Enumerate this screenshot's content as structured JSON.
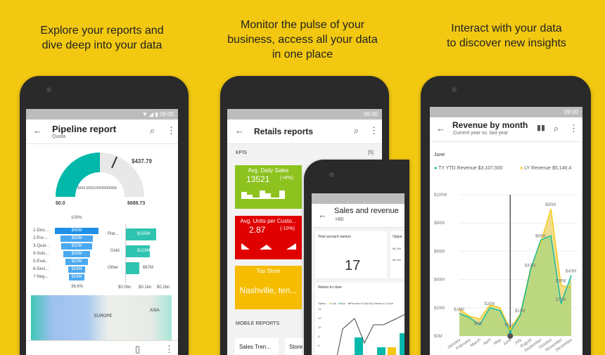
{
  "captions": [
    "Explore your reports and\ndive deep into your data",
    "Monitor the pulse of your\nbusiness, access all your data\nin one place",
    "Interact with your data\nto discover new insights"
  ],
  "status_time": "09:00",
  "pipeline": {
    "title": "Pipeline report",
    "subtitle": "Quota",
    "gauge": {
      "value_label": "$344.36921400000000M",
      "target": "$437.79",
      "min": "$0.0",
      "max": "$688.73",
      "fraction": 0.5,
      "target_fraction": 0.636
    },
    "funnel": {
      "top": "100%",
      "bottom": "36.6%",
      "rows": [
        {
          "label": "1-Disc...",
          "value": "$45M",
          "v": 45
        },
        {
          "label": "2-Pre-...",
          "value": "$33M",
          "v": 33
        },
        {
          "label": "3-Qual...",
          "value": "$32M",
          "v": 32
        },
        {
          "label": "4-Solu...",
          "value": "$28M",
          "v": 28
        },
        {
          "label": "5-Eval...",
          "value": "$23M",
          "v": 23
        },
        {
          "label": "6-Deci...",
          "value": "$18M",
          "v": 18
        },
        {
          "label": "7-Neg...",
          "value": "$16M",
          "v": 16
        }
      ]
    },
    "bars": {
      "rows": [
        {
          "label": "Plat...",
          "value": "$155M",
          "v": 155
        },
        {
          "label": "Gold",
          "value": "$123M",
          "v": 123
        },
        {
          "label": "Other",
          "value": "$67M",
          "v": 67
        }
      ],
      "ticks": [
        "$0.0bn",
        "$0.1bn",
        "$0.2bn"
      ]
    },
    "map": {
      "labels": [
        "EUROPE",
        "ASIA"
      ]
    }
  },
  "retail": {
    "title": "Retails reports",
    "kpis_label": "KPIS",
    "kpis_count": "[5]",
    "tiles": [
      {
        "title": "Avg. Daily Sales",
        "value": "13521",
        "change": "(+8%)",
        "color": "#8DC21F"
      },
      {
        "title": "Avg. Units per Custo...",
        "value": "2.87",
        "change": "(-10%)",
        "color": "#E00000"
      },
      {
        "title": "Top Store",
        "value": "Nashville, ten...",
        "color": "#F5BC00"
      }
    ],
    "mobile_label": "MOBILE REPORTS",
    "mobile_items": [
      "Sales Tren...",
      "Store"
    ]
  },
  "sales": {
    "title": "Sales and revenue",
    "subtitle": "HBI",
    "card1_title": "Total account owners",
    "card1_value": "17",
    "card2_title": "Oppor",
    "card2_ticks": [
      "$0.2bn",
      "$0.1bn"
    ],
    "weeks_title": "Weeks to close",
    "legend": [
      "Status",
      "Lost",
      "Won",
      "Percent of Ops By Weeks to Close"
    ],
    "yticks": [
      "14",
      "12",
      "10",
      "8",
      "6"
    ]
  },
  "revenue": {
    "title": "Revenue by month",
    "subtitle": "Current year vs. last year",
    "selected": "June",
    "legend_ty": "TY YTD Revenue $3,107,500",
    "legend_ly": "LY Revenue $5,140,4"
  },
  "chart_data": {
    "type": "area",
    "categories": [
      "January",
      "February",
      "March",
      "April",
      "May",
      "June",
      "July",
      "August",
      "September",
      "October",
      "November",
      "December"
    ],
    "series": [
      {
        "name": "TY YTD Revenue",
        "color": "#01B8AA",
        "values": [
          16,
          13,
          8,
          20,
          18,
          3,
          15,
          47,
          68,
          71,
          23,
          43
        ]
      },
      {
        "name": "LY Revenue",
        "color": "#F2C811",
        "values": [
          19,
          14,
          12,
          22,
          20,
          5,
          16,
          48,
          66,
          90,
          36,
          34
        ]
      }
    ],
    "yticks": [
      "$0M",
      "$20M",
      "$40M",
      "$60M",
      "$80M",
      "$100M"
    ],
    "ylim": [
      0,
      100
    ],
    "data_labels": [
      {
        "i": 0,
        "t": "$16M",
        "v": 16
      },
      {
        "i": 2,
        "t": "$6M",
        "v": 6
      },
      {
        "i": 3,
        "t": "$20M",
        "v": 20
      },
      {
        "i": 5,
        "t": "$5M",
        "v": 5
      },
      {
        "i": 6,
        "t": "$15M",
        "v": 15
      },
      {
        "i": 7,
        "t": "$47M",
        "v": 47
      },
      {
        "i": 8,
        "t": "$68M",
        "v": 68
      },
      {
        "i": 9,
        "t": "$90M",
        "v": 90
      },
      {
        "i": 10,
        "t": "$36M",
        "v": 36
      },
      {
        "i": 10,
        "t": "$23M",
        "v": 23
      },
      {
        "i": 11,
        "t": "$43M",
        "v": 43
      }
    ],
    "grid": true,
    "legend": "top"
  }
}
